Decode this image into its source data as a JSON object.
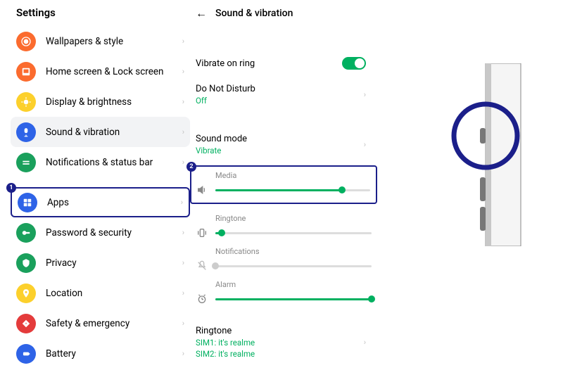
{
  "settings_title": "Settings",
  "items": {
    "wallpapers": "Wallpapers & style",
    "homescreen": "Home screen & Lock screen",
    "display": "Display & brightness",
    "sound": "Sound & vibration",
    "notifications": "Notifications & status bar",
    "apps": "Apps",
    "password": "Password & security",
    "privacy": "Privacy",
    "location": "Location",
    "safety": "Safety & emergency",
    "battery": "Battery"
  },
  "detail": {
    "title": "Sound & vibration",
    "vibrate_on_ring": "Vibrate on ring",
    "dnd_label": "Do Not Disturb",
    "dnd_value": "Off",
    "sound_mode_label": "Sound mode",
    "sound_mode_value": "Vibrate",
    "media_label": "Media",
    "ringtone_vol_label": "Ringtone",
    "notifications_vol_label": "Notifications",
    "alarm_label": "Alarm",
    "ringtone_label": "Ringtone",
    "sim1": "SIM1: it's realme",
    "sim2": "SIM2: it's realme"
  },
  "sliders": {
    "media": 82,
    "ringtone": 4,
    "notifications": 0,
    "alarm": 100
  },
  "badges": {
    "one": "1",
    "two": "2"
  },
  "colors": {
    "wallpapers": "#fb6b2e",
    "homescreen": "#fb6b2e",
    "display": "#fcd02c",
    "sound": "#2e63e7",
    "notifications": "#1aa05c",
    "apps": "#2e63e7",
    "password": "#1aa05c",
    "privacy": "#1aa05c",
    "location": "#fcd02c",
    "safety": "#e43b3b",
    "battery": "#2e63e7"
  }
}
